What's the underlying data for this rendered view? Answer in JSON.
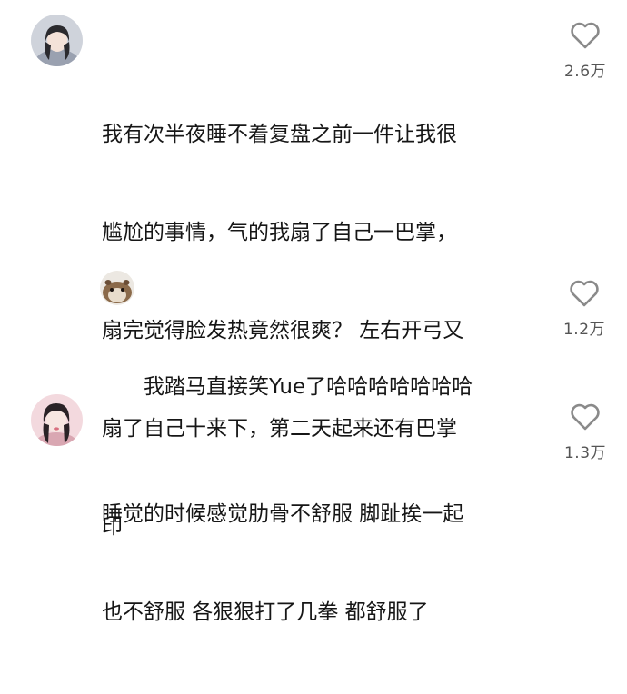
{
  "comments": [
    {
      "lines": [
        "我有次半夜睡不着复盘之前一件让我很",
        "尴尬的事情，气的我扇了自己一巴掌，",
        "扇完觉得脸发热竟然很爽？ 左右开弓又",
        "扇了自己十来下，第二天起来还有巴掌",
        "印"
      ],
      "likes": "2.6万"
    },
    {
      "lines": [
        "我踏马直接笑Yue了哈哈哈哈哈哈哈"
      ],
      "likes": "1.2万"
    },
    {
      "lines": [
        "睡觉的时候感觉肋骨不舒服 脚趾挨一起",
        "也不舒服 各狠狠打了几拳 都舒服了"
      ],
      "likes": "1.3万"
    }
  ],
  "icons": {
    "like": "heart-outline-icon",
    "avatar1": "avatar-girl-gray-sweater",
    "avatar2": "avatar-hamster",
    "avatar3": "avatar-girl-pink"
  },
  "colors": {
    "text": "#161616",
    "meta": "#555555",
    "icon": "#8a8a8a"
  }
}
